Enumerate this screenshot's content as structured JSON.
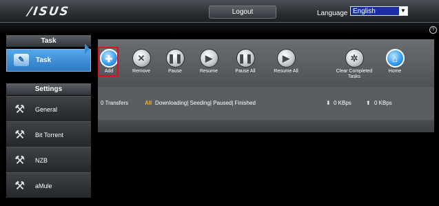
{
  "header": {
    "logo": "/ISUS",
    "logout_label": "Logout",
    "language_label": "Language",
    "language_value": "English"
  },
  "sidebar": {
    "task_header": "Task",
    "task_item": "Task",
    "settings_header": "Settings",
    "settings_items": [
      {
        "label": "General"
      },
      {
        "label": "Bit Torrent"
      },
      {
        "label": "NZB"
      },
      {
        "label": "aMule"
      }
    ]
  },
  "toolbar": {
    "add": "Add",
    "remove": "Remove",
    "pause": "Pause",
    "resume": "Resume",
    "pause_all": "Pause All",
    "resume_all": "Resume All",
    "clear_completed": "Clear Completed Tasks",
    "home": "Home"
  },
  "status": {
    "transfers": "0 Transfers",
    "filter_all": "All",
    "filters": "Downloading| Seeding| Paused| Finished",
    "download_rate": "0 KBps",
    "upload_rate": "0 KBps"
  },
  "colors": {
    "accent_blue": "#3a8ad6",
    "highlight_red": "#e0101a",
    "all_tag": "#f3b21e"
  }
}
